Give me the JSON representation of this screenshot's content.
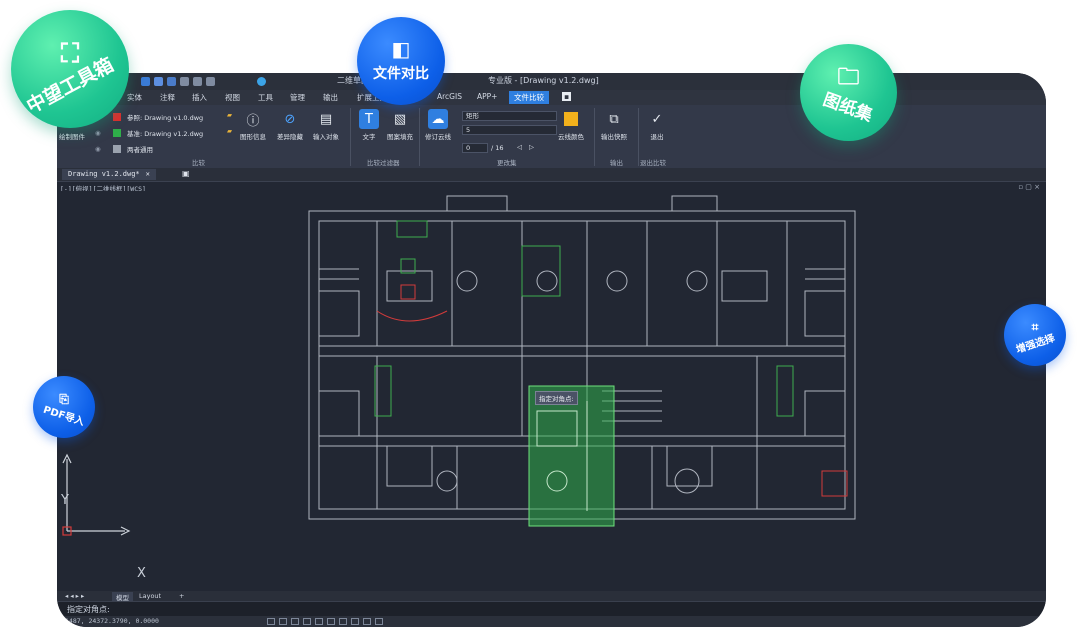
{
  "title_bar": {
    "app_prefix": "二维草图与注释",
    "document_title": "专业版 - [Drawing v1.2.dwg]"
  },
  "menu_tabs": [
    {
      "label": "实体"
    },
    {
      "label": "注释"
    },
    {
      "label": "插入"
    },
    {
      "label": "视图"
    },
    {
      "label": "工具"
    },
    {
      "label": "管理"
    },
    {
      "label": "输出"
    },
    {
      "label": "扩展工具"
    },
    {
      "label": "ArcGIS"
    },
    {
      "label": "APP+"
    },
    {
      "label": "文件比较"
    }
  ],
  "ribbon": {
    "compare_button": "绘制图件",
    "ref_label": "参照: Drawing v1.0.dwg",
    "base_label": "基准: Drawing v1.2.dwg",
    "both_label": "两者通用",
    "buttons": [
      {
        "label": "图形信息"
      },
      {
        "label": "差异隐藏"
      },
      {
        "label": "输入对象"
      },
      {
        "label": "文字"
      },
      {
        "label": "图案填充"
      },
      {
        "label": "修订云线"
      },
      {
        "label": "云线颜色"
      },
      {
        "label": "输出快照"
      },
      {
        "label": "退出"
      }
    ],
    "dropdown_1": "矩形",
    "dropdown_2": "5",
    "page_current": "0",
    "page_total": "/ 16",
    "group_labels": [
      "比较",
      "比较过滤器",
      "更改集",
      "输出",
      "退出比较"
    ]
  },
  "document_tab": {
    "label": "Drawing v1.2.dwg*"
  },
  "view_label": "[-][俯视][二维线框][WCS]",
  "canvas": {
    "tooltip": "指定对角点:",
    "axis_y": "Y",
    "axis_x": "X"
  },
  "layout_tabs": {
    "model": "模型",
    "layout": "Layout"
  },
  "command_line": {
    "prompt": "指定对角点:"
  },
  "status_bar": {
    "coords": "1487,  24372.3790,  0.0000"
  },
  "badges": {
    "toolbox": "中望工具箱",
    "file_compare": "文件对比",
    "drawing_set": "图纸集",
    "enhanced_select": "增强选择",
    "pdf_import": "PDF导入"
  },
  "colors": {
    "accent_blue": "#0d5fe8",
    "accent_green": "#1fc592",
    "cad_background": "#222733",
    "highlight_green": "#2fae4a"
  }
}
